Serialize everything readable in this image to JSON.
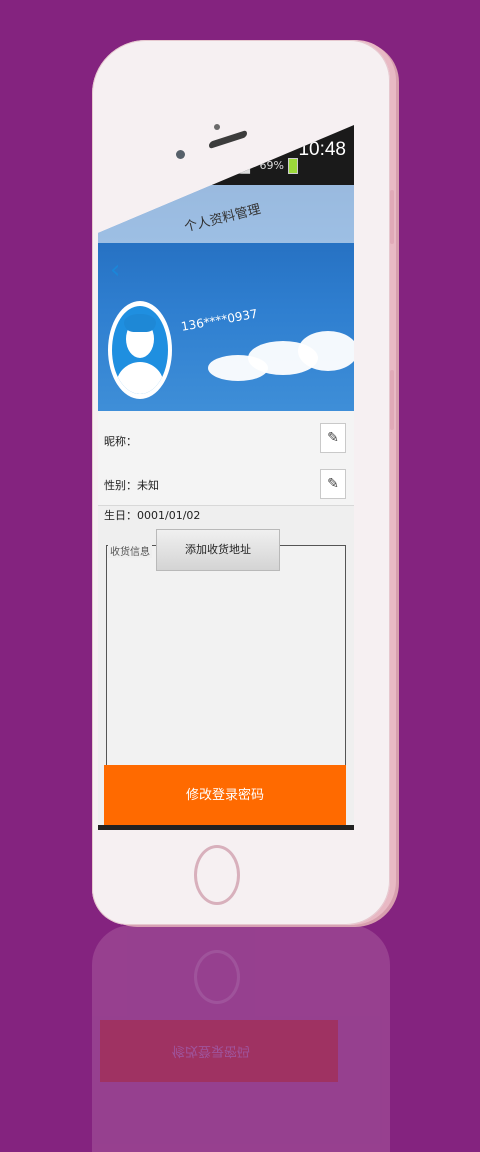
{
  "app": {
    "title": "个人资料管理"
  },
  "status_bar": {
    "time": "10:48",
    "battery": "69%",
    "network": "E"
  },
  "profile": {
    "phone": "136****0937"
  },
  "fields": {
    "nickname_label": "昵称：",
    "gender_label": "性别：未知",
    "birthday_label": "生日：0001/01/02"
  },
  "address": {
    "legend": "收货信息",
    "add_button": "添加收货地址"
  },
  "actions": {
    "change_password": "修改登录密码"
  },
  "colors": {
    "background": "#84237f",
    "accent": "#ff6a00",
    "header_blue": "#2f7fd0",
    "back_arrow": "#1b86d8"
  },
  "icons": {
    "back": "chevron-left-icon",
    "edit": "pencil-icon",
    "avatar": "user-avatar-icon"
  }
}
